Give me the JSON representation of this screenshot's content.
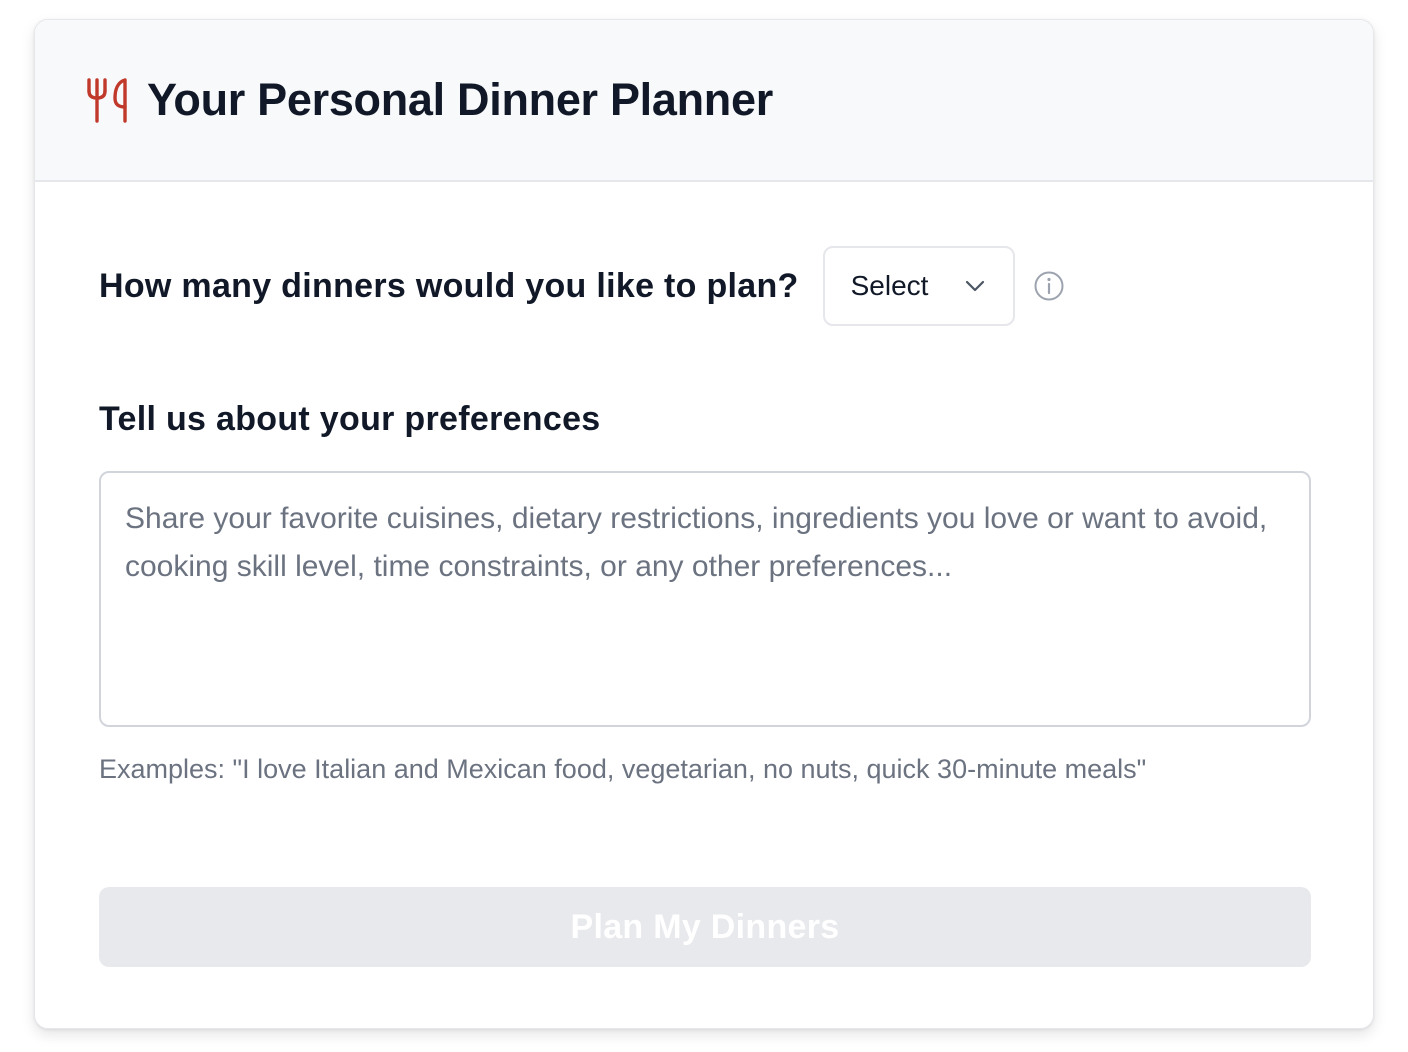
{
  "header": {
    "title": "Your Personal Dinner Planner",
    "icon": "utensils-icon",
    "icon_color": "#c0392b"
  },
  "dinner_count": {
    "label": "How many dinners would you like to plan?",
    "selected_value": "Select",
    "info_icon": "info-icon"
  },
  "preferences": {
    "label": "Tell us about your preferences",
    "value": "",
    "placeholder": "Share your favorite cuisines, dietary restrictions, ingredients you love or want to avoid, cooking skill level, time constraints, or any other preferences...",
    "hint": "Examples: \"I love Italian and Mexican food, vegetarian, no nuts, quick 30-minute meals\""
  },
  "submit": {
    "label": "Plan My Dinners",
    "disabled": true,
    "background": "#e8e9ec"
  }
}
